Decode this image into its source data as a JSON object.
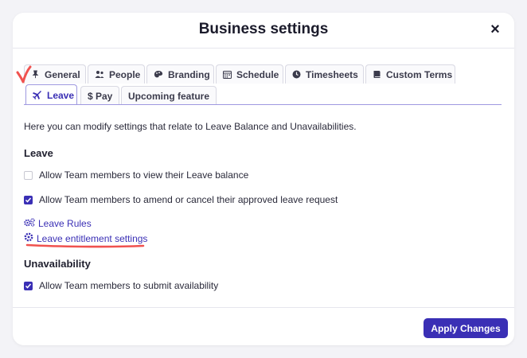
{
  "modal": {
    "title": "Business settings",
    "close_label": "×"
  },
  "tabs_row1": [
    {
      "label": "General",
      "icon": "pin-icon"
    },
    {
      "label": "People",
      "icon": "people-icon"
    },
    {
      "label": "Branding",
      "icon": "palette-icon"
    },
    {
      "label": "Schedule",
      "icon": "calendar-icon"
    },
    {
      "label": "Timesheets",
      "icon": "clock-icon"
    },
    {
      "label": "Custom Terms",
      "icon": "book-icon"
    }
  ],
  "tabs_row2": [
    {
      "label": "Leave",
      "icon": "plane-icon",
      "active": true
    },
    {
      "label": "$ Pay"
    },
    {
      "label": "Upcoming feature"
    }
  ],
  "description": "Here you can modify settings that relate to Leave Balance and Unavailabilities.",
  "leave": {
    "title": "Leave",
    "options": [
      {
        "label": "Allow Team members to view their Leave balance",
        "checked": false
      },
      {
        "label": "Allow Team members to amend or cancel their approved leave request",
        "checked": true
      }
    ],
    "links": [
      {
        "label": "Leave Rules",
        "icon": "gears-icon"
      },
      {
        "label": "Leave entitlement settings",
        "icon": "gear-icon"
      }
    ]
  },
  "unavailability": {
    "title": "Unavailability",
    "options": [
      {
        "label": "Allow Team members to submit availability",
        "checked": true
      }
    ]
  },
  "footer": {
    "apply_label": "Apply Changes"
  },
  "colors": {
    "accent": "#3a2fb5",
    "annotation": "#f0524f"
  }
}
